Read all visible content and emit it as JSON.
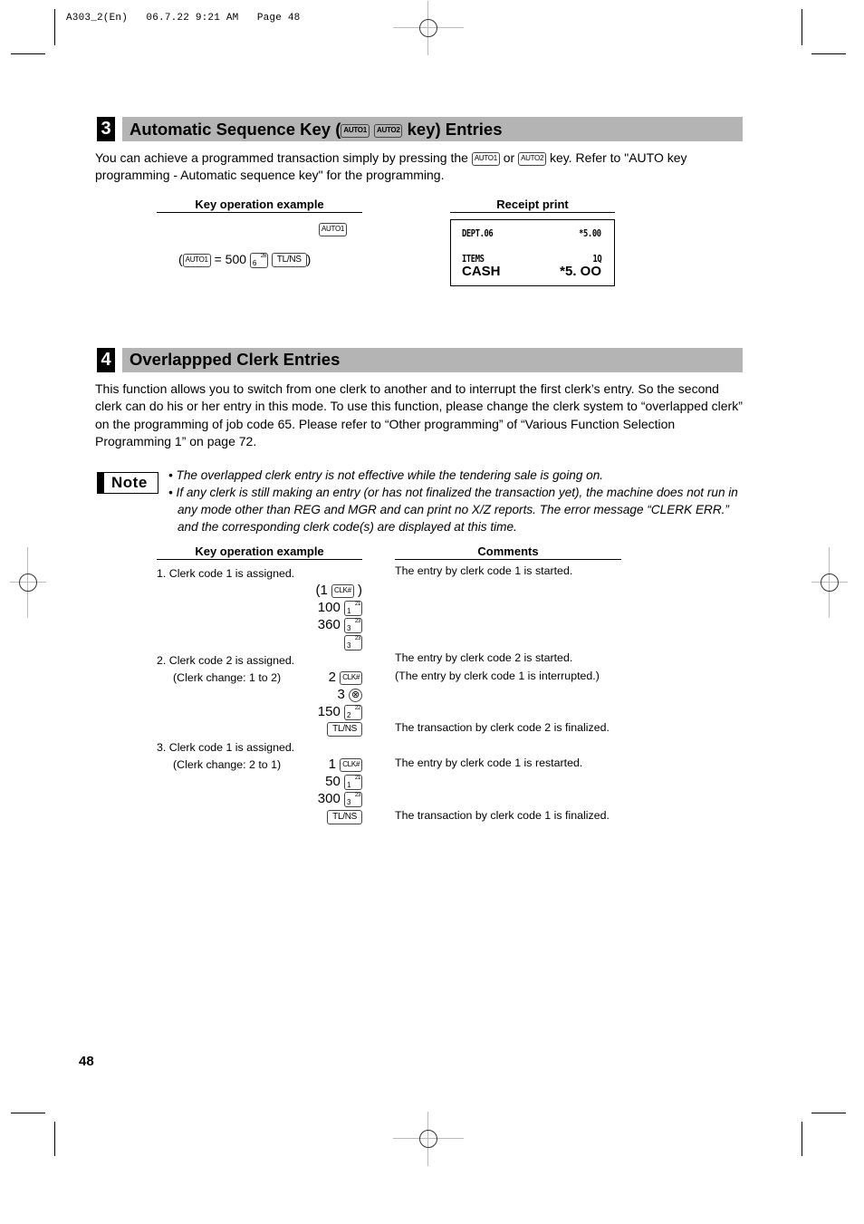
{
  "print_header": "A303_2(En)   06.7.22 9:21 AM   Page 48",
  "section3": {
    "number": "3",
    "title_prefix": "Automatic Sequence Key (",
    "title_keys": [
      "AUTO1",
      "AUTO2"
    ],
    "title_suffix": " key) Entries",
    "intro_part1": "You can achieve a programmed transaction simply by pressing the ",
    "intro_key1": "AUTO1",
    "intro_or": " or ",
    "intro_key2": "AUTO2",
    "intro_part2": " key.  Refer to \"AUTO key programming - Automatic sequence key\" for the programming.",
    "key_op_heading": "Key operation example",
    "receipt_heading": "Receipt print",
    "key_op": {
      "key_pressed": "AUTO1",
      "paren_open": "(",
      "equals_key": "AUTO1",
      "equals_text": " = 500 ",
      "dept_key_main": "6",
      "dept_key_sup": "26",
      "total_key": "TL/NS",
      "paren_close": ")"
    },
    "receipt": {
      "rows": [
        {
          "left": "DEPT.06",
          "right": "*5.00"
        },
        {
          "left": "ITEMS",
          "right": "1Q"
        },
        {
          "left": "CASH",
          "right": "*5. OO"
        }
      ]
    }
  },
  "section4": {
    "number": "4",
    "title": "Overlappped Clerk Entries",
    "intro": "This function allows you to switch from one clerk to another and to interrupt the first clerk’s entry. So the second clerk can do his or her entry in this mode.  To use this function, please change the clerk system to “overlapped clerk” on the programming of job code 65.  Please refer to “Other programming” of “Various Function Selection Programming 1” on page 72.",
    "note_label": "Note",
    "notes": [
      "• The overlapped clerk entry is not effective while the tendering sale is going on.",
      "• If any clerk is still making an entry (or has not finalized the transaction yet), the machine does not run in any mode other than REG and MGR and can print no X/Z reports. The error message “CLERK ERR.” and the corresponding clerk code(s) are displayed at this time."
    ],
    "key_op_heading": "Key operation example",
    "comments_heading": "Comments",
    "steps": [
      {
        "label": "1. Clerk code 1 is assigned.",
        "sublabel": "",
        "ops": [
          {
            "prefix": "(1 ",
            "key": "CLK#",
            "suffix": " )"
          },
          {
            "prefix": "100 ",
            "key_main": "1",
            "key_sup": "21"
          },
          {
            "prefix": "360 ",
            "key_main": "3",
            "key_sup": "23"
          },
          {
            "prefix": "",
            "key_main": "3",
            "key_sup": "23"
          }
        ],
        "comments": [
          "The entry by clerk code 1 is started."
        ]
      },
      {
        "label": "2. Clerk code 2 is assigned.",
        "sublabel": "(Clerk change: 1 to 2)",
        "ops": [
          {
            "prefix": "2 ",
            "key": "CLK#"
          },
          {
            "prefix": "3 ",
            "key": "⊗"
          },
          {
            "prefix": "150 ",
            "key_main": "2",
            "key_sup": "22"
          },
          {
            "prefix": "",
            "key": "TL/NS"
          }
        ],
        "comments": [
          "The entry by clerk code 2 is started.",
          "(The entry by clerk code 1 is interrupted.)",
          "The transaction by clerk code 2 is finalized."
        ]
      },
      {
        "label": "3. Clerk code 1 is assigned.",
        "sublabel": "(Clerk change: 2 to 1)",
        "ops": [
          {
            "prefix": "1 ",
            "key": "CLK#"
          },
          {
            "prefix": "50 ",
            "key_main": "1",
            "key_sup": "21"
          },
          {
            "prefix": "300 ",
            "key_main": "3",
            "key_sup": "23"
          },
          {
            "prefix": "",
            "key": "TL/NS"
          }
        ],
        "comments": [
          "The entry by clerk code 1 is restarted.",
          "The transaction by clerk code 1 is finalized."
        ]
      }
    ]
  },
  "page_number": "48"
}
